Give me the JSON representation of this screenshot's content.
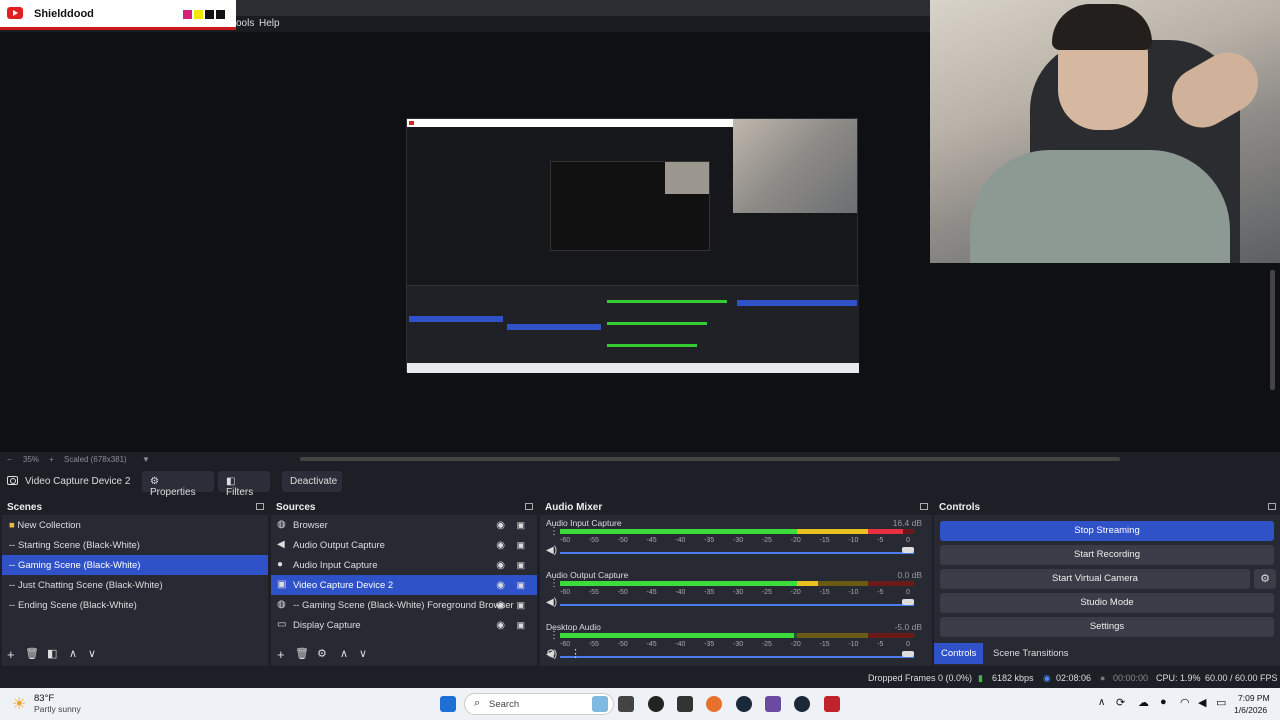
{
  "menu": {
    "items": [
      "ools",
      "Help"
    ]
  },
  "overlay": {
    "channel_name": "Shielddood",
    "swatch_colors": [
      "#d6207a",
      "#f5e800",
      "#111111",
      "#111111"
    ]
  },
  "preview": {
    "zoom_label": "35%",
    "scale_label": "Scaled (678x381)"
  },
  "source_toolbar": {
    "source_name": "Video Capture Device 2",
    "properties_label": "Properties",
    "filters_label": "Filters",
    "deactivate_label": "Deactivate"
  },
  "scenes": {
    "title": "Scenes",
    "items": [
      {
        "label": "New Collection",
        "selected": false
      },
      {
        "label": "-- Starting Scene (Black-White)",
        "selected": false
      },
      {
        "label": "-- Gaming Scene (Black-White)",
        "selected": true
      },
      {
        "label": "-- Just Chatting Scene (Black-White)",
        "selected": false
      },
      {
        "label": "-- Ending Scene (Black-White)",
        "selected": false
      }
    ]
  },
  "sources": {
    "title": "Sources",
    "items": [
      {
        "label": "Browser",
        "icon": "globe-icon",
        "selected": false
      },
      {
        "label": "Audio Output Capture",
        "icon": "speaker-icon",
        "selected": false
      },
      {
        "label": "Audio Input Capture",
        "icon": "microphone-icon",
        "selected": false
      },
      {
        "label": "Video Capture Device 2",
        "icon": "camera-icon",
        "selected": true
      },
      {
        "label": "-- Gaming Scene (Black-White)  Foreground Browser",
        "icon": "globe-icon",
        "selected": false
      },
      {
        "label": "Display Capture",
        "icon": "monitor-icon",
        "selected": false
      }
    ]
  },
  "audio_mixer": {
    "title": "Audio Mixer",
    "scale": [
      "-60",
      "-55",
      "-50",
      "-45",
      "-40",
      "-35",
      "-30",
      "-25",
      "-20",
      "-15",
      "-10",
      "-5",
      "0"
    ],
    "channels": [
      {
        "name": "Audio Input Capture",
        "db": "16.4 dB",
        "level": 0.97,
        "volume": 1.0
      },
      {
        "name": "Audio Output Capture",
        "db": "0.0 dB",
        "level": 0.73,
        "volume": 1.0
      },
      {
        "name": "Desktop Audio",
        "db": "-5.0 dB",
        "level": 0.66,
        "volume": 1.0
      }
    ]
  },
  "controls": {
    "title": "Controls",
    "buttons": [
      "Stop Streaming",
      "Start Recording",
      "Start Virtual Camera",
      "Studio Mode",
      "Settings"
    ],
    "tabs": [
      "Controls",
      "Scene Transitions"
    ]
  },
  "status": {
    "dropped_frames": "Dropped Frames 0 (0.0%)",
    "bitrate": "6182 kbps",
    "stream_time": "02:08:06",
    "record_time": "00:00:00",
    "cpu": "CPU: 1.9%",
    "fps": "60.00 / 60.00 FPS"
  },
  "taskbar": {
    "weather_temp": "83°F",
    "weather_desc": "Partly sunny",
    "search_placeholder": "Search",
    "time": "7:09 PM",
    "date": "1/6/2026"
  }
}
